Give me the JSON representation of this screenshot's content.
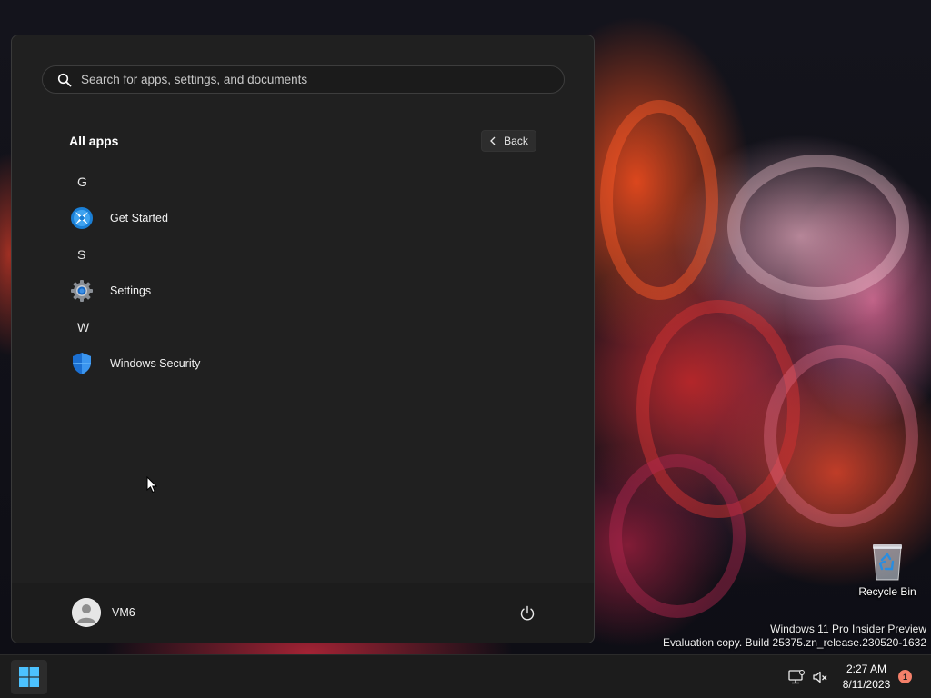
{
  "start_menu": {
    "search": {
      "placeholder": "Search for apps, settings, and documents",
      "value": ""
    },
    "all_apps_title": "All apps",
    "back_label": "Back",
    "groups": [
      {
        "letter": "G",
        "apps": [
          {
            "label": "Get Started",
            "icon": "get-started-icon"
          }
        ]
      },
      {
        "letter": "S",
        "apps": [
          {
            "label": "Settings",
            "icon": "settings-gear-icon"
          }
        ]
      },
      {
        "letter": "W",
        "apps": [
          {
            "label": "Windows Security",
            "icon": "shield-icon"
          }
        ]
      }
    ],
    "user": {
      "name": "VM6",
      "icon": "user-avatar-icon"
    },
    "power_icon": "power-icon"
  },
  "desktop": {
    "recycle_bin_label": "Recycle Bin",
    "watermark": {
      "line1": "Windows 11 Pro Insider Preview",
      "line2": "Evaluation copy. Build 25375.zn_release.230520-1632"
    }
  },
  "taskbar": {
    "start_icon": "windows-logo-icon",
    "tray_icons": [
      "network-icon",
      "volume-muted-icon"
    ],
    "clock": {
      "time": "2:27 AM",
      "date": "8/11/2023"
    },
    "notification_count": "1"
  },
  "colors": {
    "menu_bg": "#202020",
    "accent_blue": "#0078d4",
    "notification_badge": "#f4806a"
  }
}
